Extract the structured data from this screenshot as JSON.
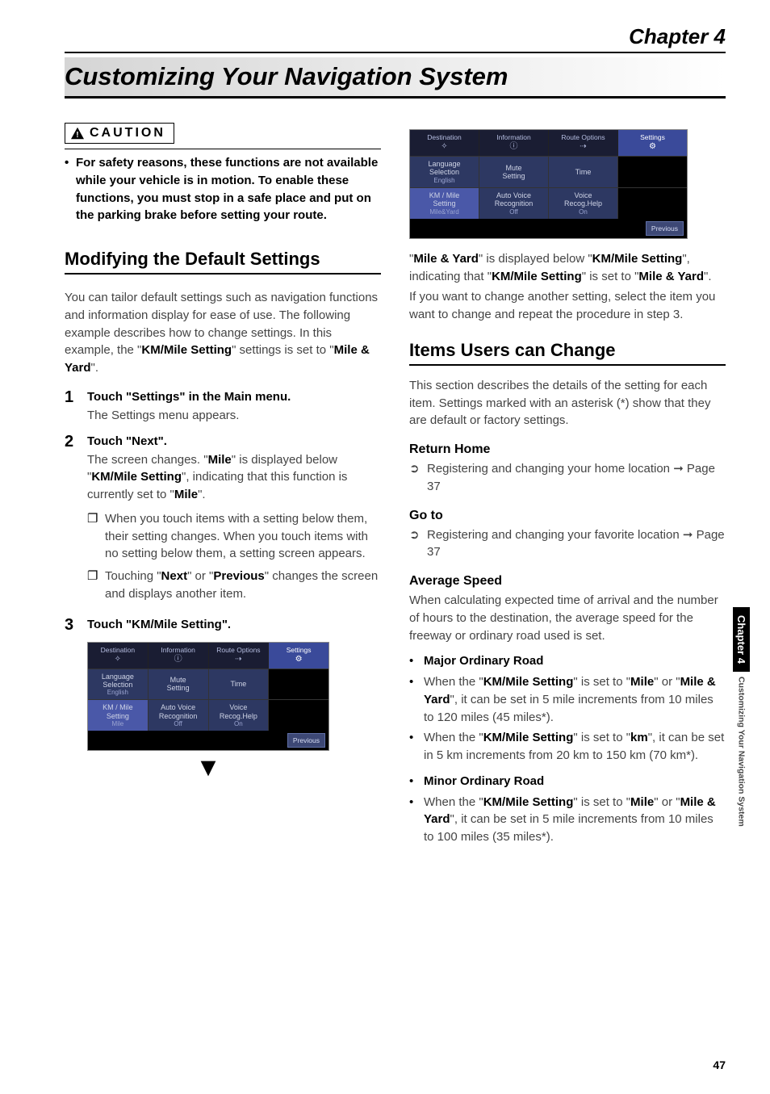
{
  "chapter_label": "Chapter 4",
  "page_title": "Customizing Your Navigation System",
  "caution": {
    "label": "CAUTION",
    "body": "For safety reasons, these functions are not available while your vehicle is in motion. To enable these functions, you must stop in a safe place and put on the parking brake before setting your route."
  },
  "sec1": {
    "heading": "Modifying the Default Settings",
    "intro_pre": "You can tailor default settings such as navigation functions and information display for ease of use. The following example describes how to change settings. In this example, the \"",
    "intro_b1": "KM/Mile Setting",
    "intro_mid": "\" settings is set to \"",
    "intro_b2": "Mile & Yard",
    "intro_post": "\"."
  },
  "steps": [
    {
      "num": "1",
      "title": "Touch \"Settings\" in the Main menu.",
      "text": "The Settings menu appears."
    },
    {
      "num": "2",
      "title": "Touch \"Next\".",
      "text_pre": "The screen changes. \"",
      "b1": "Mile",
      "text_mid1": "\" is displayed below \"",
      "b2": "KM/Mile Setting",
      "text_mid2": "\", indicating that this function is currently set to \"",
      "b3": "Mile",
      "text_post": "\".",
      "sub": [
        {
          "mark": "❐",
          "text": "When you touch items with a setting below them, their setting changes. When you touch items with no setting below them, a setting screen appears."
        },
        {
          "mark": "❐",
          "pre": "Touching \"",
          "b1": "Next",
          "mid": "\" or \"",
          "b2": "Previous",
          "post": "\" changes the screen and displays another item."
        }
      ]
    },
    {
      "num": "3",
      "title": "Touch \"KM/Mile Setting\"."
    }
  ],
  "screenshot": {
    "tabs": [
      {
        "label": "Destination",
        "glyph": "✧"
      },
      {
        "label": "Information",
        "glyph": "ⓘ"
      },
      {
        "label": "Route Options",
        "glyph": "⇢"
      },
      {
        "label": "Settings",
        "glyph": "⚙",
        "active": true
      }
    ],
    "row1": [
      {
        "l1": "Language",
        "l2": "Selection",
        "l3": "English"
      },
      {
        "l1": "Mute",
        "l2": "Setting"
      },
      {
        "l1": "Time"
      },
      {
        "empty": true
      }
    ],
    "row2_mile": [
      {
        "l1": "KM / Mile",
        "l2": "Setting",
        "l3": "Mile"
      },
      {
        "l1": "Auto Voice",
        "l2": "Recognition",
        "l3": "Off"
      },
      {
        "l1": "Voice",
        "l2": "Recog.Help",
        "l3": "On"
      },
      {
        "empty": true
      }
    ],
    "row2_yard": [
      {
        "l1": "KM / Mile",
        "l2": "Setting",
        "l3": "Mile&Yard"
      },
      {
        "l1": "Auto Voice",
        "l2": "Recognition",
        "l3": "Off"
      },
      {
        "l1": "Voice",
        "l2": "Recog.Help",
        "l3": "On"
      },
      {
        "empty": true
      }
    ],
    "previous": "Previous"
  },
  "result": {
    "q1": "\"",
    "b1": "Mile & Yard",
    "t1": "\" is displayed below \"",
    "b2": "KM/Mile Setting",
    "t2": "\", indicating that \"",
    "b3": "KM/Mile Setting",
    "t3": "\" is set to \"",
    "b4": "Mile & Yard",
    "t4": "\".",
    "after": "If you want to change another setting, select the item you want to change and repeat the procedure in step 3."
  },
  "sec2": {
    "heading": "Items Users can Change",
    "intro": "This section describes the details of the setting for each item. Settings marked with an asterisk (*) show that they are default or factory settings."
  },
  "return_home": {
    "heading": "Return Home",
    "ref": "Registering and changing your home location ➞ Page 37"
  },
  "goto": {
    "heading": "Go to",
    "ref": "Registering and changing your favorite location ➞ Page 37"
  },
  "avg": {
    "heading": "Average Speed",
    "intro": "When calculating expected time of arrival and the number of hours to the destination, the average speed for the freeway or ordinary road used is set.",
    "items": [
      {
        "type": "title",
        "text": "Major Ordinary Road"
      },
      {
        "type": "mixed",
        "pre": "When the \"",
        "b1": "KM/Mile Setting",
        "m1": "\" is set to \"",
        "b2": "Mile",
        "m2": "\" or \"",
        "b3": "Mile & Yard",
        "m3": "\", it can be set in 5 mile increments from 10 miles to 120 miles (45 miles*)."
      },
      {
        "type": "mixed",
        "pre": "When the \"",
        "b1": "KM/Mile Setting",
        "m1": "\" is set to \"",
        "b2": "km",
        "m2": "\", it can be set in 5 km increments from 20 km to 150 km (70 km*).",
        "b3": "",
        "m3": ""
      },
      {
        "type": "title",
        "text": "Minor Ordinary Road"
      },
      {
        "type": "mixed",
        "pre": "When the \"",
        "b1": "KM/Mile Setting",
        "m1": "\" is set to \"",
        "b2": "Mile",
        "m2": "\" or \"",
        "b3": "Mile & Yard",
        "m3": "\", it can be set in 5 mile increments from 10 miles to 100 miles (35 miles*)."
      }
    ]
  },
  "side": {
    "chapter": "Chapter 4",
    "rest": "Customizing Your Navigation System"
  },
  "page_number": "47"
}
